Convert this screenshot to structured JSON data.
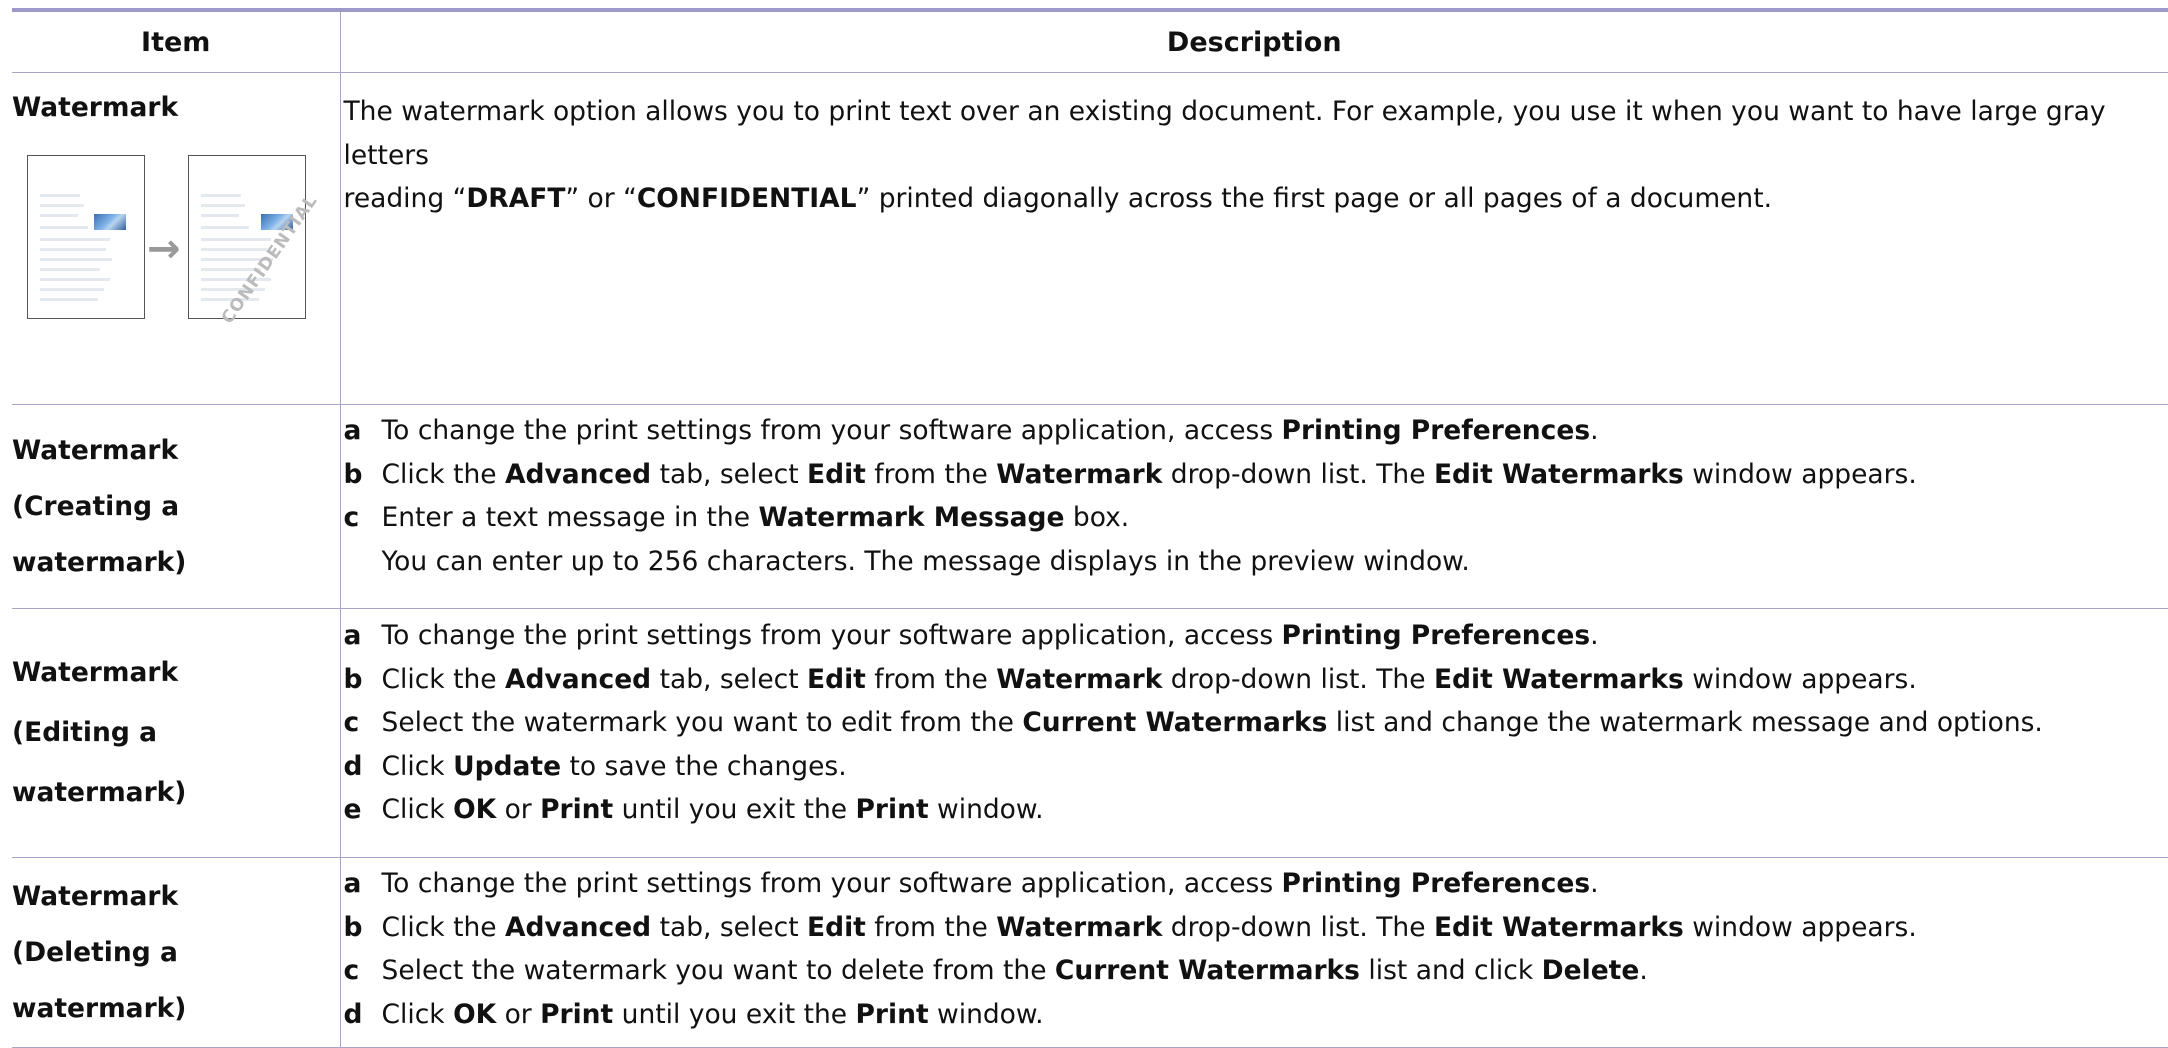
{
  "headers": {
    "item": "Item",
    "description": "Description"
  },
  "rows": [
    {
      "item_lines": [
        "Watermark"
      ],
      "description": {
        "seg1": "The watermark option allows you to print text over an existing document. For example, you use it when you want to have large gray letters",
        "seg2": "reading “",
        "bold1": "DRAFT",
        "seg3": "” or “",
        "bold2": "CONFIDENTIAL",
        "seg4": "” printed diagonally across the first page or all pages of a document."
      },
      "illustration": {
        "watermark_text": "CONFIDENTIAL",
        "arrow": "→"
      }
    },
    {
      "item_lines": [
        "Watermark",
        "(Creating a",
        "watermark)"
      ],
      "steps": [
        {
          "letter": "a",
          "parts": [
            {
              "t": "To change the print settings from your software application, access "
            },
            {
              "t": "Printing Preferences",
              "b": true
            },
            {
              "t": "."
            }
          ]
        },
        {
          "letter": "b",
          "parts": [
            {
              "t": "Click the "
            },
            {
              "t": "Advanced",
              "b": true
            },
            {
              "t": " tab, select "
            },
            {
              "t": "Edit",
              "b": true
            },
            {
              "t": " from the "
            },
            {
              "t": "Watermark",
              "b": true
            },
            {
              "t": " drop-down list. The "
            },
            {
              "t": "Edit Watermarks",
              "b": true
            },
            {
              "t": " window appears."
            }
          ]
        },
        {
          "letter": "c",
          "parts": [
            {
              "t": "Enter a text message in the "
            },
            {
              "t": "Watermark Message",
              "b": true
            },
            {
              "t": " box."
            }
          ]
        }
      ],
      "continuation": "You can enter up to 256 characters. The message displays in the preview window."
    },
    {
      "item_lines": [
        "Watermark",
        "(Editing a watermark)"
      ],
      "steps": [
        {
          "letter": "a",
          "parts": [
            {
              "t": "To change the print settings from your software application, access "
            },
            {
              "t": "Printing Preferences",
              "b": true
            },
            {
              "t": "."
            }
          ]
        },
        {
          "letter": "b",
          "parts": [
            {
              "t": "Click the "
            },
            {
              "t": "Advanced",
              "b": true
            },
            {
              "t": " tab, select "
            },
            {
              "t": "Edit",
              "b": true
            },
            {
              "t": " from the "
            },
            {
              "t": "Watermark",
              "b": true
            },
            {
              "t": " drop-down list. The "
            },
            {
              "t": "Edit Watermarks",
              "b": true
            },
            {
              "t": " window appears."
            }
          ]
        },
        {
          "letter": "c",
          "parts": [
            {
              "t": "Select the watermark you want to edit from the "
            },
            {
              "t": "Current Watermarks",
              "b": true
            },
            {
              "t": " list and change the watermark message and options."
            }
          ]
        },
        {
          "letter": "d",
          "parts": [
            {
              "t": "Click "
            },
            {
              "t": "Update",
              "b": true
            },
            {
              "t": " to save the changes."
            }
          ]
        },
        {
          "letter": "e",
          "parts": [
            {
              "t": "Click "
            },
            {
              "t": "OK",
              "b": true
            },
            {
              "t": " or "
            },
            {
              "t": "Print",
              "b": true
            },
            {
              "t": " until you exit the "
            },
            {
              "t": "Print",
              "b": true
            },
            {
              "t": " window."
            }
          ]
        }
      ]
    },
    {
      "item_lines": [
        "Watermark",
        "(Deleting a",
        "watermark)"
      ],
      "steps": [
        {
          "letter": "a",
          "parts": [
            {
              "t": "To change the print settings from your software application, access "
            },
            {
              "t": "Printing Preferences",
              "b": true
            },
            {
              "t": "."
            }
          ]
        },
        {
          "letter": "b",
          "parts": [
            {
              "t": "Click the "
            },
            {
              "t": "Advanced",
              "b": true
            },
            {
              "t": " tab, select "
            },
            {
              "t": "Edit",
              "b": true
            },
            {
              "t": " from the "
            },
            {
              "t": "Watermark",
              "b": true
            },
            {
              "t": " drop-down list. The "
            },
            {
              "t": "Edit Watermarks",
              "b": true
            },
            {
              "t": " window appears."
            }
          ]
        },
        {
          "letter": "c",
          "parts": [
            {
              "t": "Select the watermark you want to delete from the "
            },
            {
              "t": "Current Watermarks",
              "b": true
            },
            {
              "t": " list and click "
            },
            {
              "t": "Delete",
              "b": true
            },
            {
              "t": "."
            }
          ]
        },
        {
          "letter": "d",
          "parts": [
            {
              "t": "Click "
            },
            {
              "t": "OK",
              "b": true
            },
            {
              "t": " or "
            },
            {
              "t": "Print",
              "b": true
            },
            {
              "t": " until you exit the "
            },
            {
              "t": "Print",
              "b": true
            },
            {
              "t": " window."
            }
          ]
        }
      ]
    }
  ]
}
